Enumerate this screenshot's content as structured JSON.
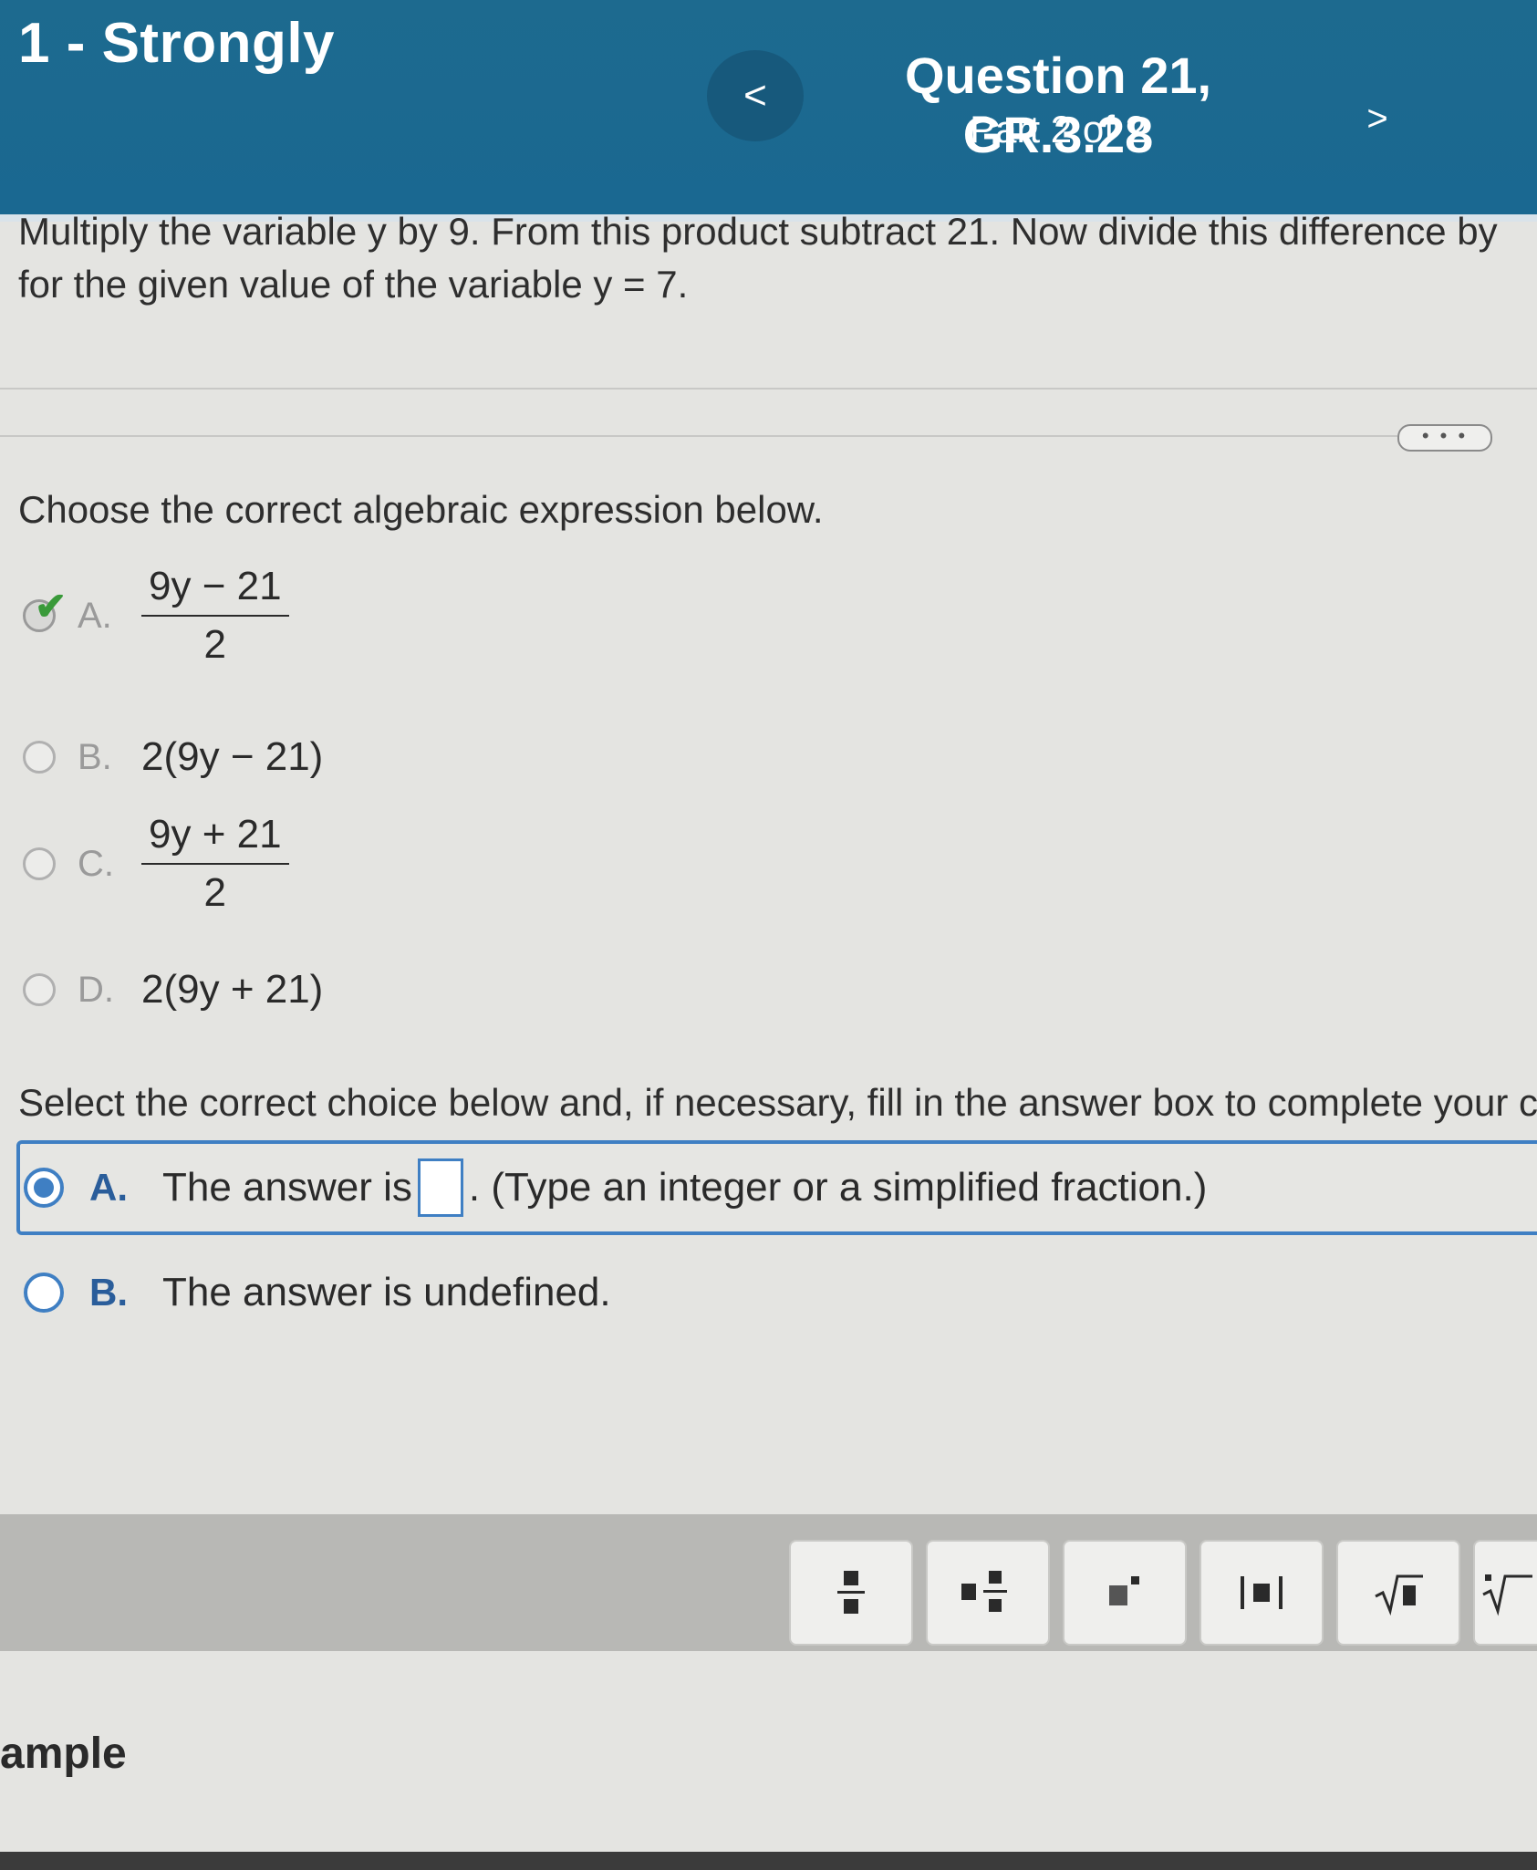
{
  "header": {
    "left_text": "1 - Strongly",
    "prev_label": "<",
    "question_title": "Question 21, GR.3.28",
    "question_part": "Part 2 of 2",
    "next_label": ">"
  },
  "problem_text": "Multiply the variable y by 9. From this product subtract 21. Now divide this difference by",
  "problem_text_line2": "for the given value of the variable y = 7.",
  "more_button_label": "• • •",
  "part1": {
    "prompt": "Choose the correct algebraic expression below.",
    "options": [
      {
        "letter": "A.",
        "numerator": "9y − 21",
        "denominator": "2",
        "selected": true
      },
      {
        "letter": "B.",
        "expression": "2(9y − 21)",
        "selected": false
      },
      {
        "letter": "C.",
        "numerator": "9y + 21",
        "denominator": "2",
        "selected": false
      },
      {
        "letter": "D.",
        "expression": "2(9y + 21)",
        "selected": false
      }
    ]
  },
  "part2": {
    "prompt": "Select the correct choice below and, if necessary, fill in the answer box to complete your c",
    "choice_a": {
      "letter": "A.",
      "text_before": "The answer is",
      "text_after": ". (Type an integer or a simplified fraction.)",
      "selected": true,
      "input_value": ""
    },
    "choice_b": {
      "letter": "B.",
      "text": "The answer is undefined.",
      "selected": false
    }
  },
  "toolbar": {
    "buttons": [
      "fraction-icon",
      "mixed-number-icon",
      "exponent-icon",
      "absolute-value-icon",
      "square-root-icon",
      "nth-root-icon"
    ]
  },
  "footer_text": "ample"
}
